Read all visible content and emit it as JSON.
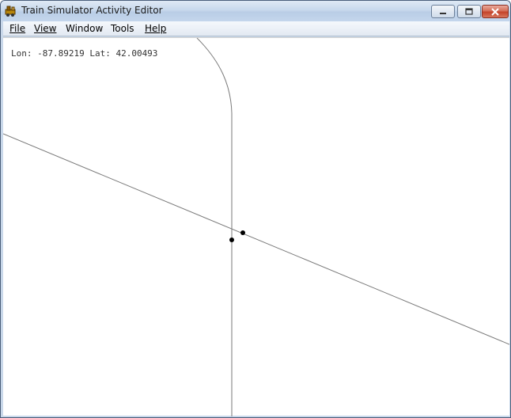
{
  "window": {
    "title": "Train Simulator Activity Editor"
  },
  "menu": {
    "items": [
      {
        "label": "File",
        "mnemonic": "F"
      },
      {
        "label": "View",
        "mnemonic": "V"
      },
      {
        "label": "Window",
        "mnemonic": ""
      },
      {
        "label": "Tools",
        "mnemonic": ""
      },
      {
        "label": "Help",
        "mnemonic": "H"
      }
    ]
  },
  "status": {
    "coords": "Lon: -87.89219 Lat: 42.00493"
  },
  "icons": {
    "app": "locomotive-icon",
    "minimize": "minimize-icon",
    "maximize": "maximize-icon",
    "close": "close-icon"
  },
  "colors": {
    "track_line": "#7a7a7a",
    "node": "#000000",
    "canvas_bg": "#ffffff"
  }
}
